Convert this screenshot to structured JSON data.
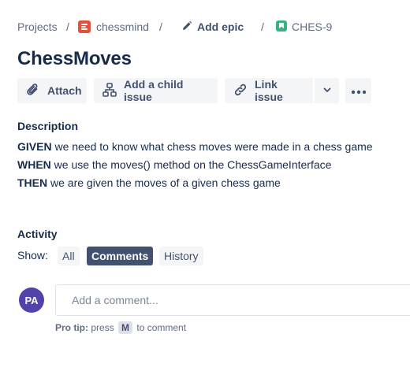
{
  "breadcrumb": {
    "projects": "Projects",
    "separator": "/",
    "project": "chessmind",
    "add_epic": "Add epic",
    "issue_key": "CHES-9"
  },
  "issue": {
    "title": "ChessMoves"
  },
  "toolbar": {
    "attach": "Attach",
    "add_child": "Add a child issue",
    "link_issue": "Link issue"
  },
  "description": {
    "label": "Description",
    "lines": [
      {
        "keyword": "GIVEN",
        "text": " we need to know what chess moves were made in a chess game"
      },
      {
        "keyword": "WHEN",
        "text": " we use the moves() method on the ChessGameInterface"
      },
      {
        "keyword": "THEN",
        "text": " we are given the moves of a given chess game"
      }
    ]
  },
  "activity": {
    "label": "Activity",
    "show_label": "Show:",
    "filters": [
      "All",
      "Comments",
      "History"
    ],
    "active_filter": "Comments"
  },
  "comment": {
    "avatar_initials": "PA",
    "placeholder": "Add a comment...",
    "tip_prefix": "Pro tip:",
    "tip_press": "press",
    "tip_key": "M",
    "tip_suffix": "to comment"
  },
  "colors": {
    "project_icon": "#e2513a",
    "story_icon": "#36b37e",
    "avatar": "#5243aa",
    "active_chip": "#42526e",
    "button_bg": "#f4f5f7"
  },
  "icons": {
    "project": "project-icon",
    "pencil": "pencil-icon",
    "story": "story-icon",
    "attach": "paperclip-icon",
    "child": "hierarchy-icon",
    "link": "link-icon",
    "dropdown": "chevron-down-icon",
    "more": "more-icon"
  }
}
